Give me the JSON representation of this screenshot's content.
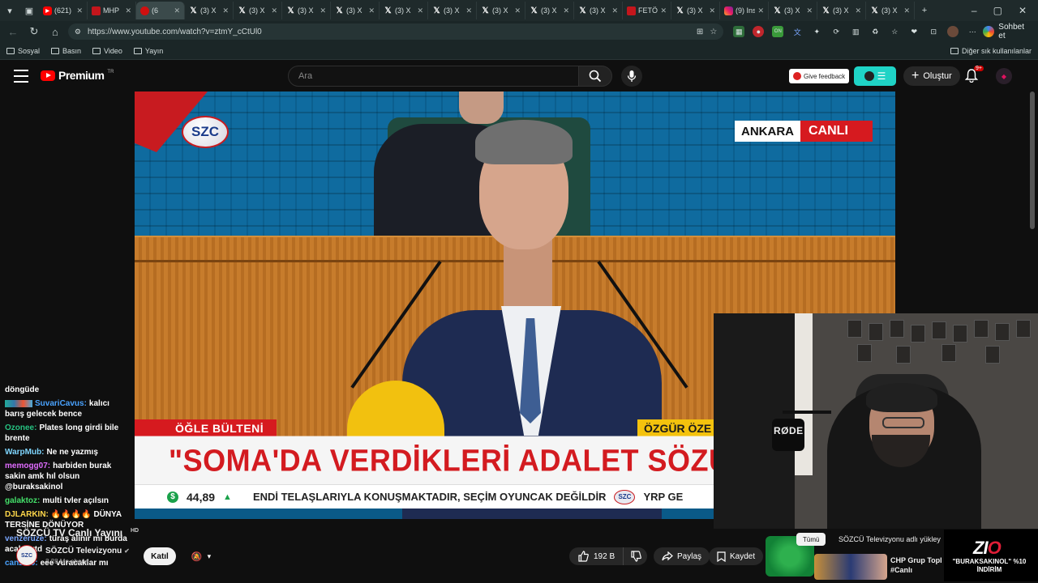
{
  "browser": {
    "tabs": [
      {
        "icon": "youtube",
        "label": "(621)"
      },
      {
        "icon": "news-red",
        "label": "MHP"
      },
      {
        "icon": "youtube-live",
        "label": "(6",
        "active": true
      },
      {
        "icon": "x",
        "label": "(3) X"
      },
      {
        "icon": "x",
        "label": "(3) X"
      },
      {
        "icon": "x",
        "label": "(3) X"
      },
      {
        "icon": "x",
        "label": "(3) X"
      },
      {
        "icon": "x",
        "label": "(3) X"
      },
      {
        "icon": "x",
        "label": "(3) X"
      },
      {
        "icon": "x",
        "label": "(3) X"
      },
      {
        "icon": "x",
        "label": "(3) X"
      },
      {
        "icon": "x",
        "label": "(3) X"
      },
      {
        "icon": "news-red",
        "label": "FETÖ"
      },
      {
        "icon": "x",
        "label": "(3) X"
      },
      {
        "icon": "instagram",
        "label": "(9) Ins"
      },
      {
        "icon": "x",
        "label": "(3) X"
      },
      {
        "icon": "x",
        "label": "(3) X"
      },
      {
        "icon": "x",
        "label": "(3) X"
      }
    ],
    "url": "https://www.youtube.com/watch?v=ztmY_cCtUl0",
    "chat_button": "Sohbet et",
    "bookmarks": [
      "Sosyal",
      "Basın",
      "Video",
      "Yayın"
    ],
    "bookmarks_other": "Diğer sık kullanılanlar"
  },
  "youtube": {
    "logo_text": "Premium",
    "logo_sup": "TR",
    "search_placeholder": "Ara",
    "feedback_label": "Give feedback",
    "create_label": "Oluştur",
    "notification_count": "9+"
  },
  "video": {
    "channel_logo": "SZC",
    "live_city": "ANKARA",
    "live_label": "CANLI",
    "bulletin": "ÖĞLE BÜLTENİ",
    "lower_name": "ÖZGÜR ÖZE",
    "headline": "\"SOMA'DA VERDİKLERİ ADALET SÖZÜNÜ TU",
    "ticker_price": "44,89",
    "ticker_text": "ENDİ TELAŞLARIYLA KONUŞMAKTADIR, SEÇİM OYUNCAK DEĞİLDİR",
    "ticker_logo": "SZC",
    "ticker_tail": "YRP GE"
  },
  "webcam": {
    "mic_brand": "RØDE"
  },
  "chat": [
    {
      "user": "",
      "text": "döngüde",
      "color": "#ffffff",
      "badges": false
    },
    {
      "user": "SuvariCavus:",
      "text": "kalıcı barış gelecek bence",
      "color": "#4aa3ff",
      "badges": true
    },
    {
      "user": "Ozonee:",
      "text": "Plates long girdi bile brente",
      "color": "#26c281",
      "badges": false
    },
    {
      "user": "WarpMub:",
      "text": "Ne ne yazmış",
      "color": "#7fd6ff",
      "badges": false
    },
    {
      "user": "memogg07:",
      "text": "harbiden burak sakin amk hıl olsun @buraksakinol",
      "color": "#e06cff",
      "badges": false
    },
    {
      "user": "galaktoz:",
      "text": "multi tvler açılsın",
      "color": "#44e06a",
      "badges": false
    },
    {
      "user": "DJLARKIN:",
      "text": "🔥🔥🔥🔥 DÜNYA TERSİNE DÖNÜYOR",
      "color": "#ffd84a",
      "badges": false
    },
    {
      "user": "venzeruze:",
      "text": "türaş alınır mı burda acaba ytd",
      "color": "#7aa7ff",
      "badges": false
    },
    {
      "user": "canzr05:",
      "text": "eee vuracaklar mı",
      "color": "#4aa3ff",
      "badges": false
    }
  ],
  "below": {
    "title": "SÖZCÜ TV Canlı Yayını",
    "title_badge": "HD",
    "channel_avatar": "SZC",
    "channel_name": "SÖZCÜ Televizyonu",
    "subscribers": "2,28 Mn abone",
    "join": "Katıl",
    "likes": "192 B",
    "share": "Paylaş",
    "save": "Kaydet"
  },
  "suggestions": {
    "chip_all": "Tümü",
    "chip_channel": "SÖZCÜ Televizyonu adlı yükley",
    "rec_title": "CHP Grup Topl #Canlı",
    "promo_logo_a": "ZI",
    "promo_logo_b": "O",
    "promo_code": "\"BURAKSAKINOL\" %10 İNDİRİM"
  },
  "colors": {
    "accent_red": "#d61a1f",
    "yt_red": "#ff0000",
    "bulletin_yellow": "#f4c20d",
    "browser_chrome": "#1f2a2b"
  }
}
